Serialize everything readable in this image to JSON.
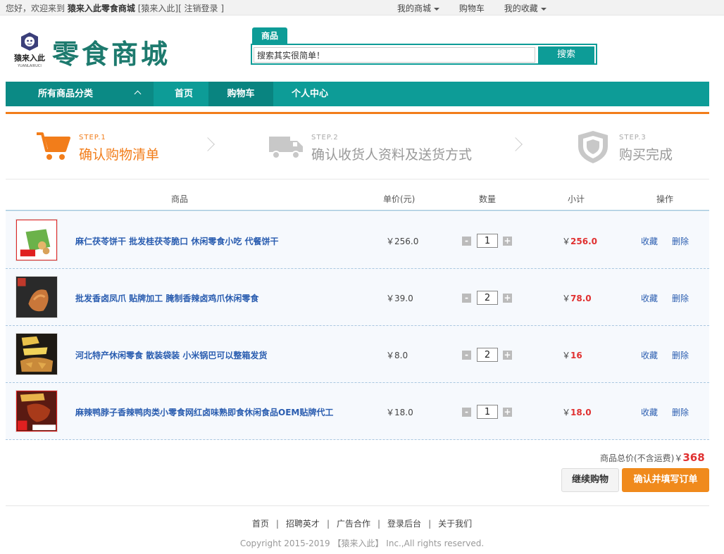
{
  "topbar": {
    "greeting": "您好，欢迎来到",
    "site_name": "猿来入此零食商城",
    "user_link": "[猿来入此]",
    "logout_link": "[ 注销登录 ]",
    "my_mall": "我的商城",
    "cart": "购物车",
    "favorites": "我的收藏"
  },
  "header": {
    "logo_text": "猿来入此",
    "logo_subtext": "YUANLAIRUCI",
    "site_title": "零食商城",
    "search_tab": "商品",
    "search_value": "搜索其实很简单！",
    "search_button": "搜索"
  },
  "nav": {
    "category_label": "所有商品分类",
    "links": [
      "首页",
      "购物车",
      "个人中心"
    ]
  },
  "steps": [
    {
      "label": "STEP.1",
      "title": "确认购物清单"
    },
    {
      "label": "STEP.2",
      "title": "确认收货人资料及送货方式"
    },
    {
      "label": "STEP.3",
      "title": "购买完成"
    }
  ],
  "table": {
    "headers": {
      "product": "商品",
      "price": "单价(元)",
      "qty": "数量",
      "subtotal": "小计",
      "ops": "操作"
    },
    "rows": [
      {
        "name": "麻仁茯苓饼干 批发桂茯苓脆口 休闲零食小吃 代餐饼干",
        "price": "￥256.0",
        "qty": "1",
        "sub_currency": "￥",
        "sub_value": "256.0"
      },
      {
        "name": "批发香卤凤爪 贴牌加工 腌制香辣卤鸡爪休闲零食",
        "price": "￥39.0",
        "qty": "2",
        "sub_currency": "￥",
        "sub_value": "78.0"
      },
      {
        "name": "河北特产休闲零食 散装袋装 小米锅巴可以整箱发货",
        "price": "￥8.0",
        "qty": "2",
        "sub_currency": "￥",
        "sub_value": "16"
      },
      {
        "name": "麻辣鸭脖子香辣鸭肉类小零食网红卤味熟即食休闲食品OEM贴牌代工",
        "price": "￥18.0",
        "qty": "1",
        "sub_currency": "￥",
        "sub_value": "18.0"
      }
    ],
    "fav_label": "收藏",
    "del_label": "删除",
    "minus": "-",
    "plus": "+"
  },
  "summary": {
    "total_label": "商品总价(不含运费)￥",
    "total_value": "368",
    "continue_button": "继续购物",
    "confirm_button": "确认并填写订单"
  },
  "footer": {
    "links": [
      "首页",
      "招聘英才",
      "广告合作",
      "登录后台",
      "关于我们"
    ],
    "copyright": "Copyright 2015-2019 【猿来入此】 Inc.,All rights reserved."
  }
}
